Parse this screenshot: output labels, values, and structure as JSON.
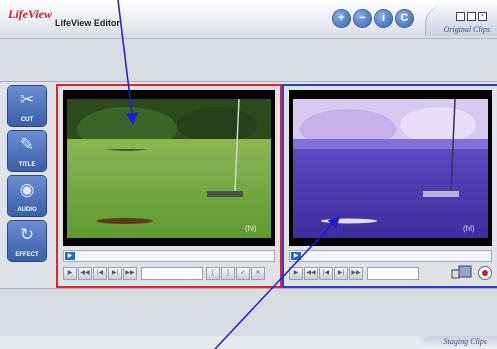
{
  "app": {
    "logo": "LifeView",
    "title": "LifeView Editor"
  },
  "header": {
    "buttons": [
      {
        "name": "add",
        "glyph": "+"
      },
      {
        "name": "remove",
        "glyph": "−"
      },
      {
        "name": "info",
        "glyph": "i"
      },
      {
        "name": "copyright",
        "glyph": "C"
      }
    ],
    "original_clips_label": "Original Clips"
  },
  "tools": [
    {
      "label": "CUT",
      "icon": "scissors-icon"
    },
    {
      "label": "TITLE",
      "icon": "pen-icon"
    },
    {
      "label": "AUDIO",
      "icon": "speaker-icon"
    },
    {
      "label": "EFFECT",
      "icon": "effect-swirl-icon"
    }
  ],
  "left_panel": {
    "watermark": "(hl)"
  },
  "right_panel": {
    "watermark": "(hl)"
  },
  "footer": {
    "staging_clips_label": "Staging Clips"
  },
  "colors": {
    "left_border": "#e3252b",
    "right_border": "#2f3dd0",
    "arrow": "#1d1dd6",
    "accent": "#2f63c4"
  }
}
